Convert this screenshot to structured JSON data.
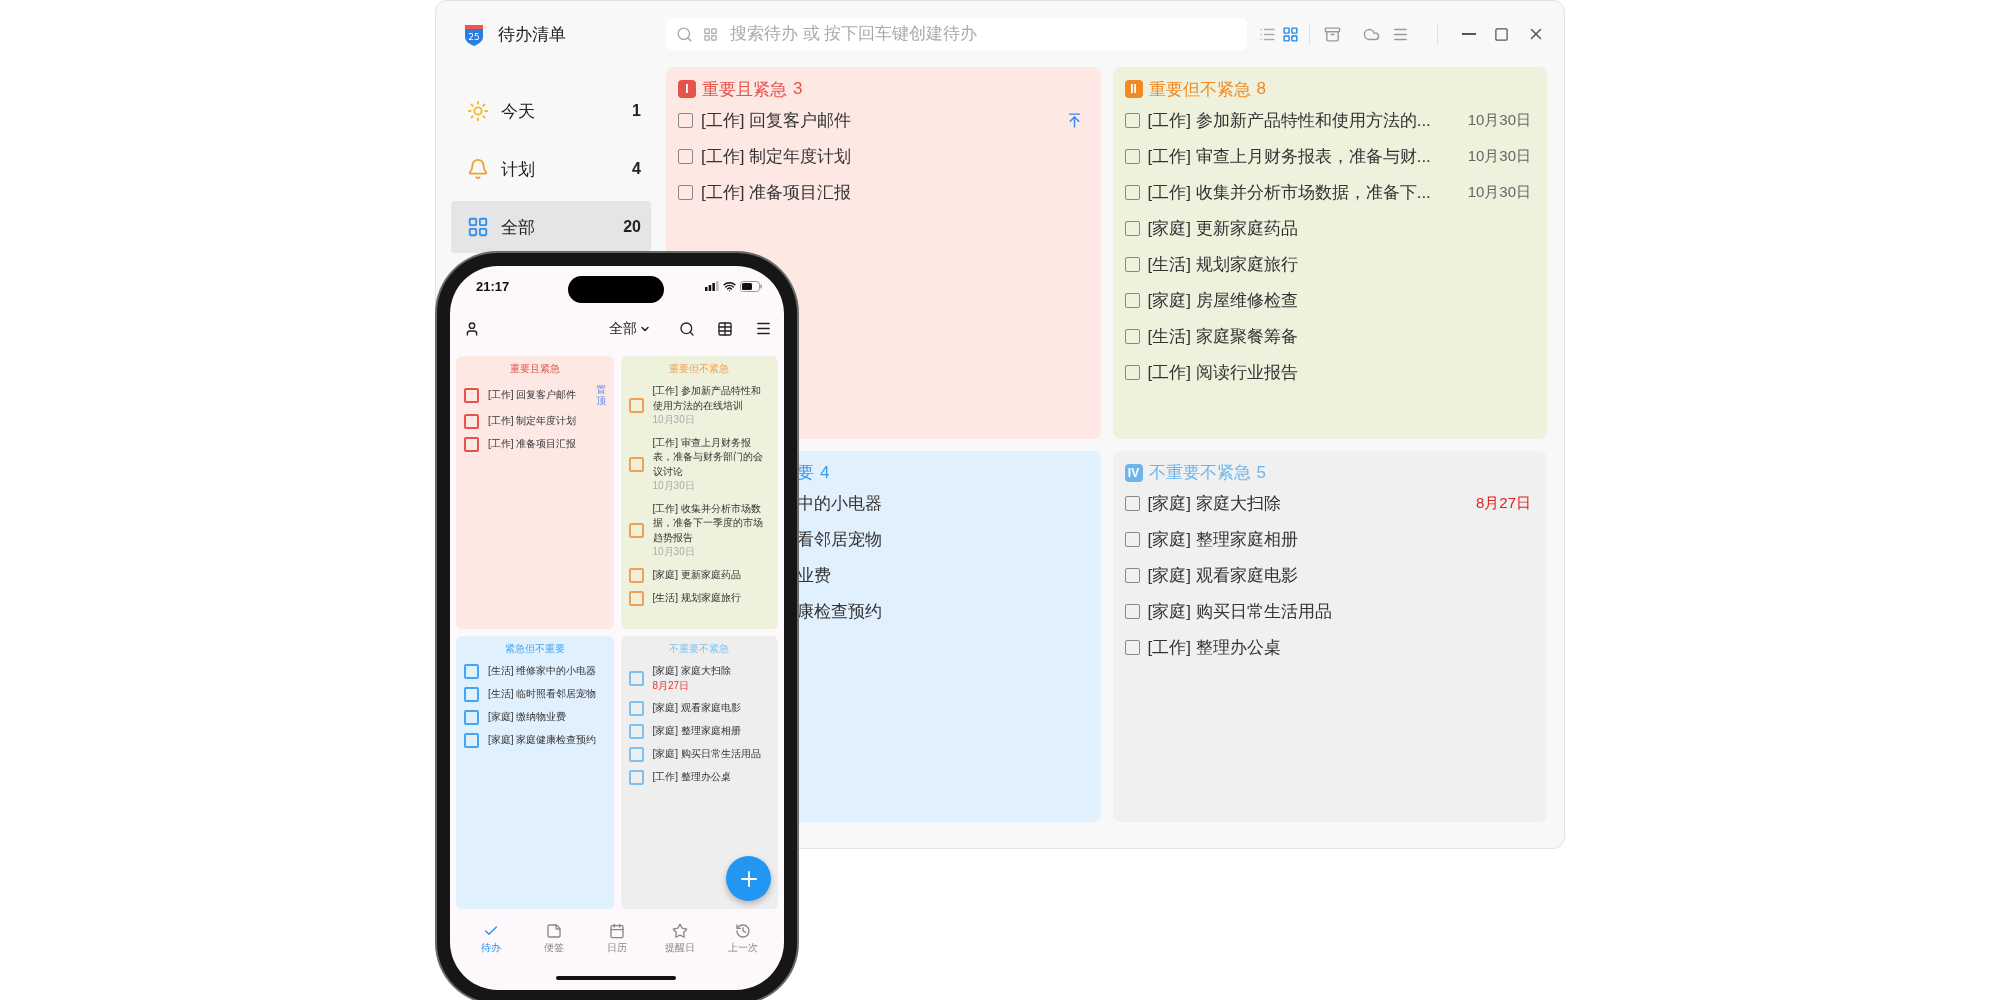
{
  "window": {
    "title": "待办清单",
    "logo_text": "25"
  },
  "search": {
    "placeholder": "搜索待办 或 按下回车键创建待办"
  },
  "view_modes": [
    {
      "kind": "list",
      "selected": false
    },
    {
      "kind": "grid",
      "selected": true
    }
  ],
  "sidebar": {
    "items": [
      {
        "kind": "today",
        "label": "今天",
        "count": "1",
        "selected": false
      },
      {
        "kind": "plan",
        "label": "计划",
        "count": "4",
        "selected": false
      },
      {
        "kind": "all",
        "label": "全部",
        "count": "20",
        "selected": true
      }
    ]
  },
  "quadrants": [
    {
      "kind": "q1",
      "badge": "I",
      "title": "重要且紧急",
      "count": "3",
      "color": "#e5534b",
      "items": [
        {
          "text": "[工作] 回复客户邮件",
          "checked": false,
          "pinned": true
        },
        {
          "text": "[工作] 制定年度计划",
          "checked": false,
          "pinned": false
        },
        {
          "text": "[工作] 准备项目汇报",
          "checked": false,
          "pinned": false
        }
      ]
    },
    {
      "kind": "q2",
      "badge": "II",
      "title": "重要但不紧急",
      "count": "8",
      "color": "#f08a24",
      "items": [
        {
          "text": "[工作] 参加新产品特性和使用方法的...",
          "checked": false,
          "date": "10月30日",
          "overdue": false
        },
        {
          "text": "[工作] 审查上月财务报表，准备与财...",
          "checked": false,
          "date": "10月30日",
          "overdue": false
        },
        {
          "text": "[工作] 收集并分析市场数据，准备下...",
          "checked": false,
          "date": "10月30日",
          "overdue": false
        },
        {
          "text": "[家庭] 更新家庭药品",
          "checked": false
        },
        {
          "text": "[生活] 规划家庭旅行",
          "checked": false
        },
        {
          "text": "[家庭] 房屋维修检查",
          "checked": false
        },
        {
          "text": "[生活] 家庭聚餐筹备",
          "checked": false
        },
        {
          "text": "[工作] 阅读行业报告",
          "checked": false
        }
      ]
    },
    {
      "kind": "q3",
      "title": "要",
      "count": "4",
      "color": "#3d9be9",
      "items": [
        {
          "text": "中的小电器"
        },
        {
          "text": "看邻居宠物"
        },
        {
          "text": "业费"
        },
        {
          "text": "康检查预约"
        }
      ]
    },
    {
      "kind": "q4",
      "badge": "IV",
      "title": "不重要不紧急",
      "count": "5",
      "color": "#6cb6ee",
      "items": [
        {
          "text": "[家庭] 家庭大扫除",
          "checked": false,
          "date": "8月27日",
          "overdue": true
        },
        {
          "text": "[家庭] 整理家庭相册",
          "checked": false
        },
        {
          "text": "[家庭] 观看家庭电影",
          "checked": false
        },
        {
          "text": "[家庭] 购买日常生活用品",
          "checked": false
        },
        {
          "text": "[工作] 整理办公桌",
          "checked": false
        }
      ]
    }
  ],
  "phone": {
    "time": "21:17",
    "filter": "全部",
    "quadrants": [
      {
        "kind": "q1",
        "title": "重要且紧急",
        "color": "#e5534b",
        "items": [
          {
            "text": "[工作] 回复客户邮件",
            "checked": false,
            "pin_label": "置顶"
          },
          {
            "text": "[工作] 制定年度计划",
            "checked": false
          },
          {
            "text": "[工作] 准备项目汇报",
            "checked": false
          }
        ]
      },
      {
        "kind": "q2",
        "title": "重要但不紧急",
        "color": "#f0a050",
        "items": [
          {
            "text": "[工作] 参加新产品特性和使用方法的在线培训",
            "checked": false,
            "date": "10月30日",
            "overdue": false
          },
          {
            "text": "[工作] 审查上月财务报表，准备与财务部门的会议讨论",
            "checked": false,
            "date": "10月30日",
            "overdue": false
          },
          {
            "text": "[工作] 收集并分析市场数据，准备下一季度的市场趋势报告",
            "checked": false,
            "date": "10月30日",
            "overdue": false
          },
          {
            "text": "[家庭] 更新家庭药品",
            "checked": false
          },
          {
            "text": "[生活] 规划家庭旅行",
            "checked": false
          }
        ]
      },
      {
        "kind": "q3",
        "title": "紧急但不重要",
        "color": "#42a5f5",
        "items": [
          {
            "text": "[生活] 维修家中的小电器",
            "checked": false
          },
          {
            "text": "[生活] 临时照看邻居宠物",
            "checked": false
          },
          {
            "text": "[家庭] 缴纳物业费",
            "checked": false
          },
          {
            "text": "[家庭] 家庭健康检查预约",
            "checked": false
          }
        ]
      },
      {
        "kind": "q4",
        "title": "不重要不紧急",
        "color": "#7ec0f0",
        "items": [
          {
            "text": "[家庭] 家庭大扫除",
            "checked": false,
            "date": "8月27日",
            "overdue": true
          },
          {
            "text": "[家庭] 观看家庭电影",
            "checked": false
          },
          {
            "text": "[家庭] 整理家庭相册",
            "checked": false
          },
          {
            "text": "[家庭] 购买日常生活用品",
            "checked": false
          },
          {
            "text": "[工作] 整理办公桌",
            "checked": false
          }
        ]
      }
    ],
    "nav": [
      {
        "kind": "todo",
        "label": "待办",
        "selected": true
      },
      {
        "kind": "notes",
        "label": "便签",
        "selected": false
      },
      {
        "kind": "calendar",
        "label": "日历",
        "selected": false
      },
      {
        "kind": "reminder",
        "label": "提醒日",
        "selected": false
      },
      {
        "kind": "history",
        "label": "上一次",
        "selected": false
      }
    ]
  }
}
